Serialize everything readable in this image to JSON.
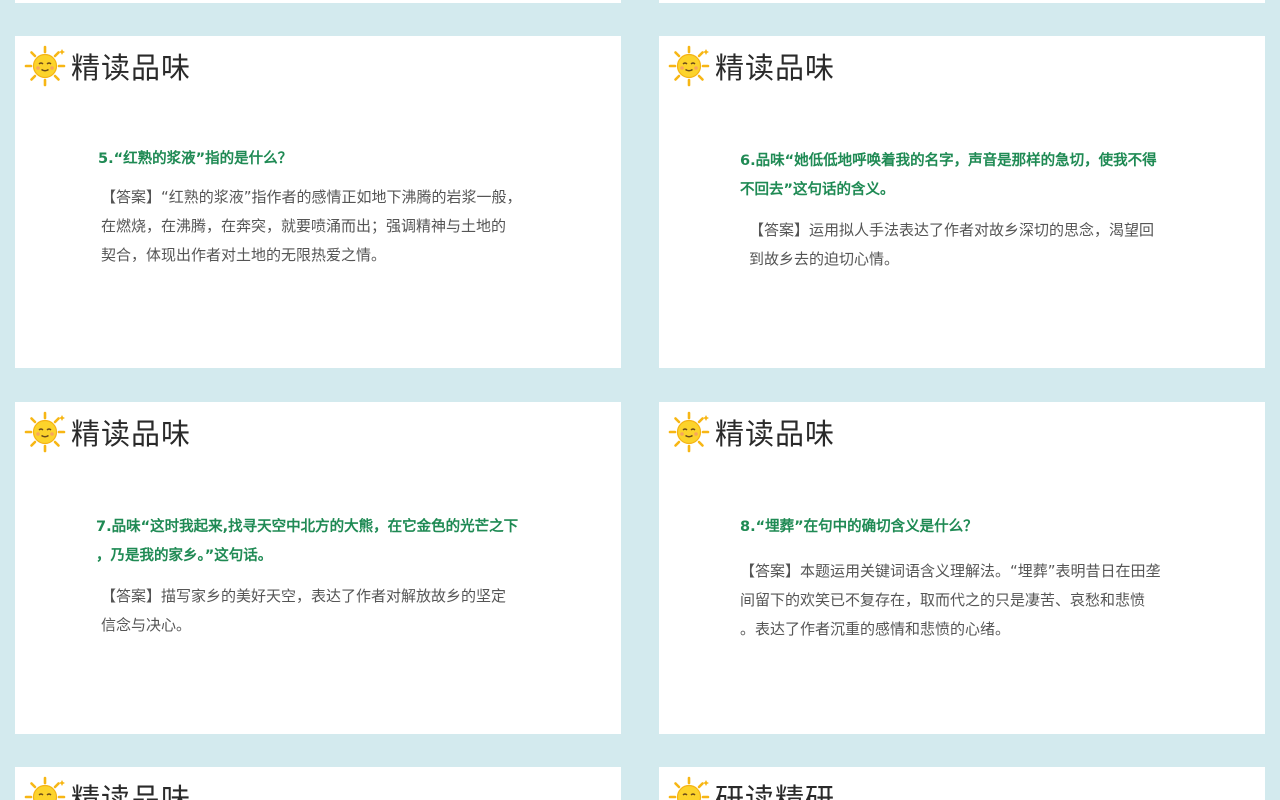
{
  "slides": [
    {
      "title": "精读品味",
      "question": "5.“红熟的浆液”指的是什么？",
      "answer": "【答案】“红熟的浆液”指作者的感情正如地下沸腾的岩浆一般，\n在燃烧，在沸腾，在奔突，就要喷涌而出；强调精神与土地的\n契合，体现出作者对土地的无限热爱之情。"
    },
    {
      "title": "精读品味",
      "question": "6.品味“她低低地呼唤着我的名字，声音是那样的急切，使我不得\n不回去”这句话的含义。",
      "answer": "【答案】运用拟人手法表达了作者对故乡深切的思念，渴望回\n到故乡去的迫切心情。"
    },
    {
      "title": "精读品味",
      "question": "7.品味“这时我起来,找寻天空中北方的大熊，在它金色的光芒之下\n，乃是我的家乡。”这句话。",
      "answer": "【答案】描写家乡的美好天空，表达了作者对解放故乡的坚定\n信念与决心。"
    },
    {
      "title": "精读品味",
      "question": "8.“埋葬”在句中的确切含义是什么？",
      "answer": "【答案】本题运用关键词语含义理解法。“埋葬”表明昔日在田垄\n间留下的欢笑已不复存在，取而代之的只是凄苦、哀愁和悲愤\n。表达了作者沉重的感情和悲愤的心绪。"
    },
    {
      "title": "精读品味"
    },
    {
      "title": "研读精研"
    }
  ]
}
